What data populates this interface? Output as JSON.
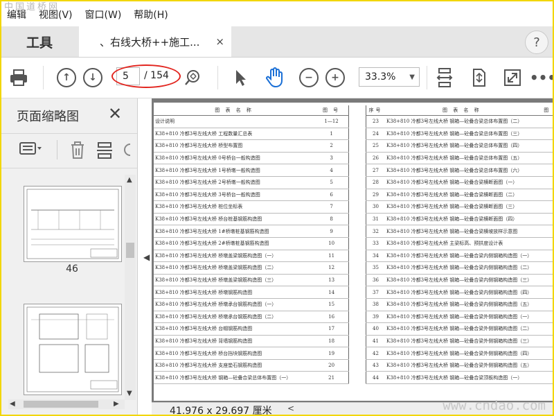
{
  "watermark": {
    "top": "中国道桥网",
    "bottom": "www.cndao.com"
  },
  "menu": [
    "编辑",
    "视图(V)",
    "窗口(W)",
    "帮助(H)"
  ],
  "tabs": {
    "tools": "工具",
    "document": "、右线大桥++施工...",
    "close_symbol": "×",
    "help_symbol": "?"
  },
  "toolbar": {
    "current_page": "5",
    "total_pages": "/ 154",
    "zoom": "33.3%",
    "icons": [
      "print-icon",
      "page-up-icon",
      "page-down-icon",
      "zoom-search-icon",
      "select-arrow-icon",
      "hand-icon",
      "zoom-out-icon",
      "zoom-in-icon",
      "fit-width-icon",
      "rotate-icon",
      "fullscreen-icon",
      "more-icon"
    ]
  },
  "sidebar": {
    "title": "页面缩略图",
    "close_symbol": "✕",
    "thumbnails": [
      {
        "label": "46"
      },
      {
        "label": ""
      }
    ]
  },
  "statusbar": {
    "dimensions": "41.976 x 29.697 厘米"
  },
  "document": {
    "header_left": [
      "图 表 名 称",
      "图 号"
    ],
    "header_right": [
      "序号",
      "图 表 名 称",
      "图 号"
    ],
    "left_rows": [
      [
        "设计说明",
        "1—12"
      ],
      [
        "K38+810 冷都3号左线大桥 工程数量汇总表",
        "1"
      ],
      [
        "K38+810 冷都3号左线大桥 桥型布置图",
        "2"
      ],
      [
        "K38+810 冷都3号左线大桥 0号桥台一般构造图",
        "3"
      ],
      [
        "K38+810 冷都3号左线大桥 1号桥墩一般构造图",
        "4"
      ],
      [
        "K38+810 冷都3号左线大桥 2号桥墩一般构造图",
        "5"
      ],
      [
        "K38+810 冷都3号左线大桥 3号桥台一般构造图",
        "6"
      ],
      [
        "K38+810 冷都3号左线大桥 桩位坐标表",
        "7"
      ],
      [
        "K38+810 冷都3号左线大桥 桥台桩基钢筋构造图",
        "8"
      ],
      [
        "K38+810 冷都3号左线大桥 1#桥墩桩基钢筋构造图",
        "9"
      ],
      [
        "K38+810 冷都3号左线大桥 2#桥墩桩基钢筋构造图",
        "10"
      ],
      [
        "K38+810 冷都3号左线大桥 桥墩盖梁钢筋构造图（一）",
        "11"
      ],
      [
        "K38+810 冷都3号左线大桥 桥墩盖梁钢筋构造图（二）",
        "12"
      ],
      [
        "K38+810 冷都3号左线大桥 桥墩盖梁钢筋构造图（三）",
        "13"
      ],
      [
        "K38+810 冷都3号左线大桥 桥墩钢筋构造图",
        "14"
      ],
      [
        "K38+810 冷都3号左线大桥 桥墩承台钢筋构造图（一）",
        "15"
      ],
      [
        "K38+810 冷都3号左线大桥 桥墩承台钢筋构造图（二）",
        "16"
      ],
      [
        "K38+810 冷都3号左线大桥 台帽钢筋构造图",
        "17"
      ],
      [
        "K38+810 冷都3号左线大桥 背墙钢筋构造图",
        "18"
      ],
      [
        "K38+810 冷都3号左线大桥 桥台挡块钢筋构造图",
        "19"
      ],
      [
        "K38+810 冷都3号左线大桥 支座垫石钢筋构造图",
        "20"
      ],
      [
        "K38+810 冷都3号左线大桥 钢箱—砼叠合梁总体布置图（一）",
        "21"
      ]
    ],
    "right_rows": [
      [
        "23",
        "K38+810 冷都3号左线大桥 钢箱—砼叠合梁总体布置图（二）"
      ],
      [
        "24",
        "K38+810 冷都3号左线大桥 钢箱—砼叠合梁总体布置图（三）"
      ],
      [
        "25",
        "K38+810 冷都3号左线大桥 钢箱—砼叠合梁总体布置图（四）"
      ],
      [
        "26",
        "K38+810 冷都3号左线大桥 钢箱—砼叠合梁总体布置图（五）"
      ],
      [
        "27",
        "K38+810 冷都3号左线大桥 钢箱—砼叠合梁总体布置图（六）"
      ],
      [
        "28",
        "K38+810 冷都3号左线大桥 钢箱—砼叠合梁横断面图（一）"
      ],
      [
        "29",
        "K38+810 冷都3号左线大桥 钢箱—砼叠合梁横断面图（二）"
      ],
      [
        "30",
        "K38+810 冷都3号左线大桥 钢箱—砼叠合梁横断面图（三）"
      ],
      [
        "31",
        "K38+810 冷都3号左线大桥 钢箱—砼叠合梁横断面图（四）"
      ],
      [
        "32",
        "K38+810 冷都3号左线大桥 钢箱—砼叠合梁横坡放样示意图"
      ],
      [
        "33",
        "K38+810 冷都3号左线大桥 主梁标高、预拱度设计表"
      ],
      [
        "34",
        "K38+810 冷都3号左线大桥 钢箱—砼叠合梁内侧钢箱构造图（一）"
      ],
      [
        "35",
        "K38+810 冷都3号左线大桥 钢箱—砼叠合梁内侧钢箱构造图（二）"
      ],
      [
        "36",
        "K38+810 冷都3号左线大桥 钢箱—砼叠合梁内侧钢箱构造图（三）"
      ],
      [
        "37",
        "K38+810 冷都3号左线大桥 钢箱—砼叠合梁内侧钢箱构造图（四）"
      ],
      [
        "38",
        "K38+810 冷都3号左线大桥 钢箱—砼叠合梁内侧钢箱构造图（五）"
      ],
      [
        "39",
        "K38+810 冷都3号左线大桥 钢箱—砼叠合梁外侧钢箱构造图（一）"
      ],
      [
        "40",
        "K38+810 冷都3号左线大桥 钢箱—砼叠合梁外侧钢箱构造图（二）"
      ],
      [
        "41",
        "K38+810 冷都3号左线大桥 钢箱—砼叠合梁外侧钢箱构造图（三）"
      ],
      [
        "42",
        "K38+810 冷都3号左线大桥 钢箱—砼叠合梁外侧钢箱构造图（四）"
      ],
      [
        "43",
        "K38+810 冷都3号左线大桥 钢箱—砼叠合梁外侧钢箱构造图（五）"
      ],
      [
        "44",
        "K38+810 冷都3号左线大桥 钢箱—砼叠合梁顶板构造图（一）"
      ]
    ]
  }
}
